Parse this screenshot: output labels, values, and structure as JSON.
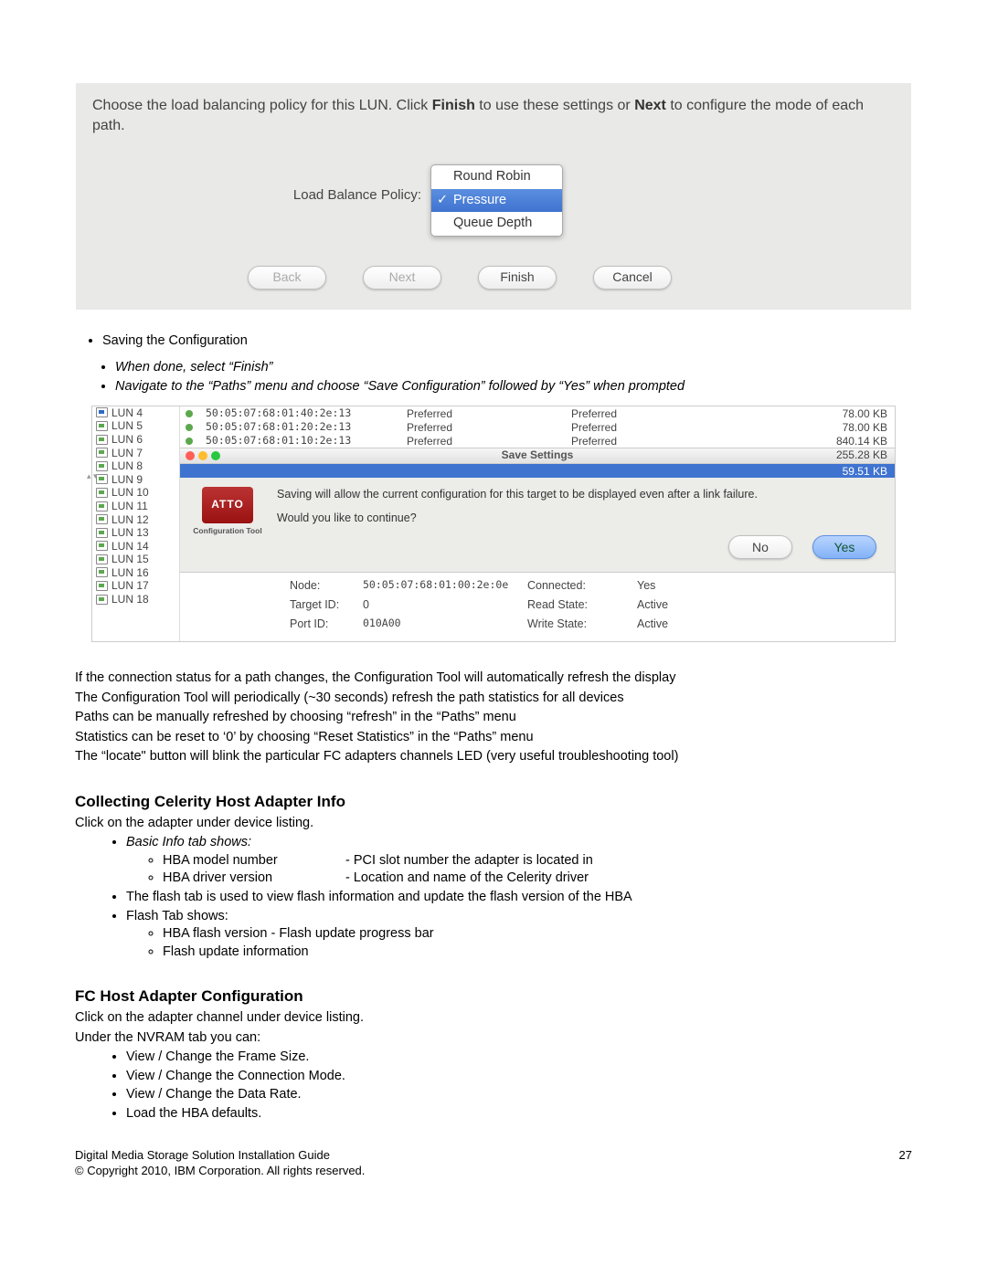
{
  "fig1": {
    "instruction_pre": "Choose the load balancing policy for this LUN. Click ",
    "instruction_b1": "Finish",
    "instruction_mid": " to use these settings or ",
    "instruction_b2": "Next",
    "instruction_post": " to configure the mode of each path.",
    "label": "Load Balance Policy:",
    "options": {
      "o1": "Round Robin",
      "o2": "Pressure",
      "o3": "Queue Depth"
    },
    "buttons": {
      "back": "Back",
      "next": "Next",
      "finish": "Finish",
      "cancel": "Cancel"
    }
  },
  "bullet_saving": "Saving the Configuration",
  "sub1": "When done, select “Finish”",
  "sub2": "Navigate to the “Paths” menu and choose “Save Configuration” followed by “Yes” when prompted",
  "fig2": {
    "luns": [
      "LUN 4",
      "LUN 5",
      "LUN 6",
      "LUN 7",
      "LUN 8",
      "LUN 9",
      "LUN 10",
      "LUN 11",
      "LUN 12",
      "LUN 13",
      "LUN 14",
      "LUN 15",
      "LUN 16",
      "LUN 17",
      "LUN 18"
    ],
    "rows": [
      {
        "addr": "50:05:07:68:01:40:2e:13",
        "c1": "Preferred",
        "c2": "Preferred",
        "size": "78.00 KB"
      },
      {
        "addr": "50:05:07:68:01:20:2e:13",
        "c1": "Preferred",
        "c2": "Preferred",
        "size": "78.00 KB"
      },
      {
        "addr": "50:05:07:68:01:10:2e:13",
        "c1": "Preferred",
        "c2": "Preferred",
        "size": "840.14 KB"
      }
    ],
    "row_extra1": "255.28 KB",
    "row_extra2": "59.51 KB",
    "save_title": "Save Settings",
    "save_line1": "Saving will allow the current configuration for this target to be displayed even after a link failure.",
    "save_line2": "Would you like to continue?",
    "atto": "ATTO",
    "atto_cap": "Configuration\nTool",
    "no": "No",
    "yes": "Yes",
    "info": {
      "node_lbl": "Node:",
      "node_val": "50:05:07:68:01:00:2e:0e",
      "conn_lbl": "Connected:",
      "conn_val": "Yes",
      "targ_lbl": "Target ID:",
      "targ_val": "0",
      "read_lbl": "Read State:",
      "read_val": "Active",
      "port_lbl": "Port ID:",
      "port_val": "010A00",
      "write_lbl": "Write State:",
      "write_val": "Active"
    }
  },
  "para": [
    "If the connection status for a path changes, the Configuration Tool will automatically refresh the display",
    "The Configuration Tool will periodically (~30 seconds)  refresh the path statistics for all devices",
    "Paths can be manually refreshed by choosing “refresh” in the “Paths” menu",
    "Statistics can be reset to ‘0’ by choosing “Reset Statistics” in the “Paths” menu",
    "The “locate\" button will blink the particular FC adapters channels LED (very useful troubleshooting tool)"
  ],
  "h_celerity": "Collecting Celerity Host Adapter Info",
  "celerity_intro": "Click on the adapter under device listing.",
  "cel_b1": "Basic Info tab shows:",
  "cel_b1a_l": "HBA model number",
  "cel_b1a_r": "-   PCI slot number the adapter is located in",
  "cel_b1b_l": "HBA driver version",
  "cel_b1b_r": "-   Location and name of the Celerity driver",
  "cel_b2": "The flash tab is used to view flash information and update the flash version of the HBA",
  "cel_b3": "Flash Tab shows:",
  "cel_b3a": "HBA flash version - Flash update progress bar",
  "cel_b3b": "Flash update information",
  "h_fc": "FC Host Adapter Configuration",
  "fc_line1": "Click on the adapter channel under device listing.",
  "fc_line2": "Under the NVRAM tab you can:",
  "fc_b1": "View / Change the Frame Size.",
  "fc_b2": "View / Change the Connection Mode.",
  "fc_b3": "View / Change the Data Rate.",
  "fc_b4": "Load the HBA defaults.",
  "footer_left1": "Digital Media Storage Solution Installation Guide",
  "footer_left2": "© Copyright 2010, IBM Corporation. All rights reserved.",
  "footer_right": "27"
}
